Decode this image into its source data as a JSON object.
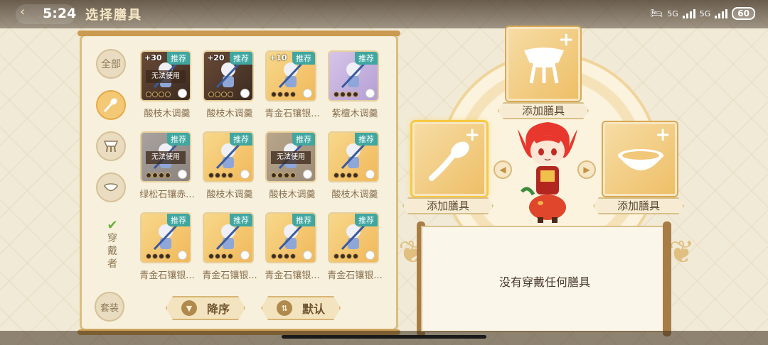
{
  "status_bar": {
    "time": "5:24",
    "network_1": "5G",
    "network_2": "5G",
    "battery": "60"
  },
  "header": {
    "title": "选择膳具"
  },
  "filters": {
    "all_label": "全部",
    "wearer_label": "穿\n戴\n者",
    "suit_label": "套装"
  },
  "items": [
    {
      "name": "酸枝木调羹",
      "plus": "+30",
      "recommend": "推荐",
      "unusable": "无法使用",
      "style": "brown"
    },
    {
      "name": "酸枝木调羹",
      "plus": "+20",
      "recommend": "推荐",
      "unusable": "",
      "style": "brown"
    },
    {
      "name": "青金石镶银...",
      "plus": "+10",
      "recommend": "推荐",
      "unusable": "",
      "style": "gold"
    },
    {
      "name": "紫檀木调羹",
      "plus": "",
      "recommend": "推荐",
      "unusable": "",
      "style": "purple"
    },
    {
      "name": "绿松石镶赤...",
      "plus": "",
      "recommend": "推荐",
      "unusable": "无法使用",
      "style": "gray"
    },
    {
      "name": "酸枝木调羹",
      "plus": "",
      "recommend": "推荐",
      "unusable": "",
      "style": "gold"
    },
    {
      "name": "酸枝木调羹",
      "plus": "",
      "recommend": "推荐",
      "unusable": "无法使用",
      "style": "faded"
    },
    {
      "name": "酸枝木调羹",
      "plus": "",
      "recommend": "推荐",
      "unusable": "",
      "style": "gold"
    },
    {
      "name": "青金石镶银...",
      "plus": "",
      "recommend": "推荐",
      "unusable": "",
      "style": "gold"
    },
    {
      "name": "青金石镶银...",
      "plus": "",
      "recommend": "推荐",
      "unusable": "",
      "style": "gold"
    },
    {
      "name": "青金石镶银...",
      "plus": "",
      "recommend": "推荐",
      "unusable": "",
      "style": "gold"
    },
    {
      "name": "青金石镶银...",
      "plus": "",
      "recommend": "推荐",
      "unusable": "",
      "style": "gold"
    }
  ],
  "sort": {
    "descending_label": "降序",
    "default_label": "默认"
  },
  "slots": {
    "top_label": "添加膳具",
    "left_label": "添加膳具",
    "right_label": "添加膳具"
  },
  "detail": {
    "empty_text": "没有穿戴任何膳具"
  },
  "colors": {
    "accent_gold": "#eebf68",
    "recommend_teal": "#3fa6a0",
    "text_brown": "#8a7050"
  }
}
